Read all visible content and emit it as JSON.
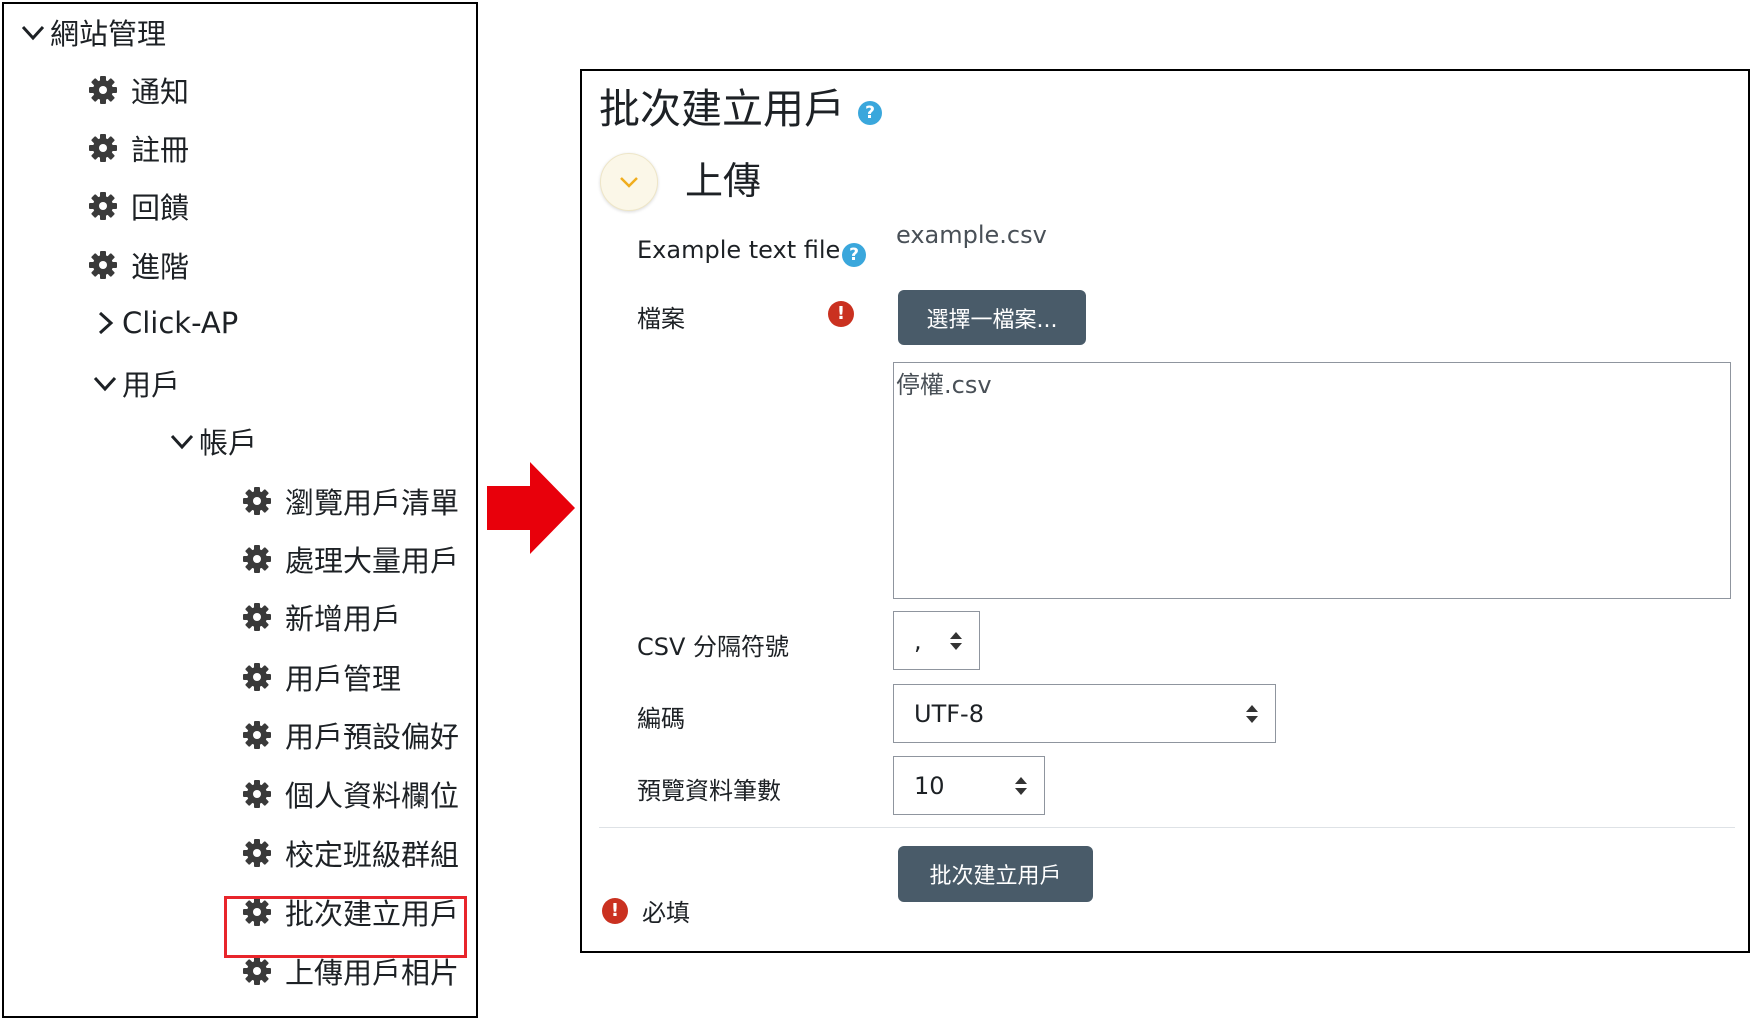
{
  "nav": {
    "root": "網站管理",
    "items_top": [
      "通知",
      "註冊",
      "回饋",
      "進階"
    ],
    "click_ap": "Click-AP",
    "users": "用戶",
    "accounts": "帳戶",
    "account_items": [
      "瀏覽用戶清單",
      "處理大量用戶",
      "新增用戶",
      "用戶管理",
      "用戶預設偏好",
      "個人資料欄位",
      "校定班級群組",
      "批次建立用戶",
      "上傳用戶相片"
    ]
  },
  "page": {
    "title": "批次建立用戶",
    "help_glyph": "?",
    "section": "上傳"
  },
  "form": {
    "example_label": "Example text file",
    "example_value": "example.csv",
    "file_label": "檔案",
    "required_glyph": "!",
    "choose_file_button": "選擇一檔案...",
    "selected_file": "停權.csv",
    "csv_delimiter_label": "CSV 分隔符號",
    "csv_delimiter_value": ",",
    "encoding_label": "編碼",
    "encoding_value": "UTF-8",
    "preview_rows_label": "預覽資料筆數",
    "preview_rows_value": "10",
    "submit_button": "批次建立用戶",
    "required_note": "必填"
  },
  "colors": {
    "highlight_border": "#e8252b",
    "arrow": "#e8000b",
    "button_bg": "#495b69",
    "help_icon": "#3aa7dc",
    "error_icon": "#ca3120"
  }
}
